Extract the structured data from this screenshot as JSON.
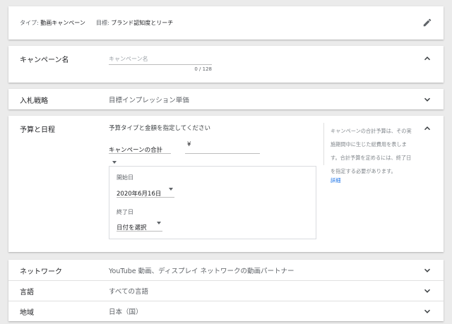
{
  "summary": {
    "type_label": "タイプ:",
    "type_value": "動画キャンペーン",
    "goal_label": "目標:",
    "goal_value": "ブランド認知度とリーチ",
    "edit_icon": "pencil-icon"
  },
  "campaign_name": {
    "label": "キャンペーン名",
    "placeholder": "キャンペーン名",
    "counter": "0 / 128"
  },
  "bidding": {
    "label": "入札戦略",
    "value": "目標インプレッション単価"
  },
  "budget": {
    "label": "予算と日程",
    "instruction": "予算タイプと金額を指定してください",
    "budget_type": "キャンペーンの合計",
    "currency": "¥",
    "start_label": "開始日",
    "start_value": "2020年6月16日",
    "end_label": "終了日",
    "end_value": "日付を選択",
    "help_text": "キャンペーンの合計予算は、その実施期間中に生じた総費用を表します。合計予算を定めるには、終了日を指定する必要があります。",
    "help_link": "詳細"
  },
  "network": {
    "label": "ネットワーク",
    "value": "YouTube 動画、ディスプレイ ネットワークの動画パートナー"
  },
  "language": {
    "label": "言語",
    "value": "すべての言語"
  },
  "location": {
    "label": "地域",
    "value": "日本（国）"
  },
  "colors": {
    "background": "#ebebeb",
    "card": "#ffffff",
    "link": "#1a73e8",
    "muted_text": "#5f6368"
  }
}
